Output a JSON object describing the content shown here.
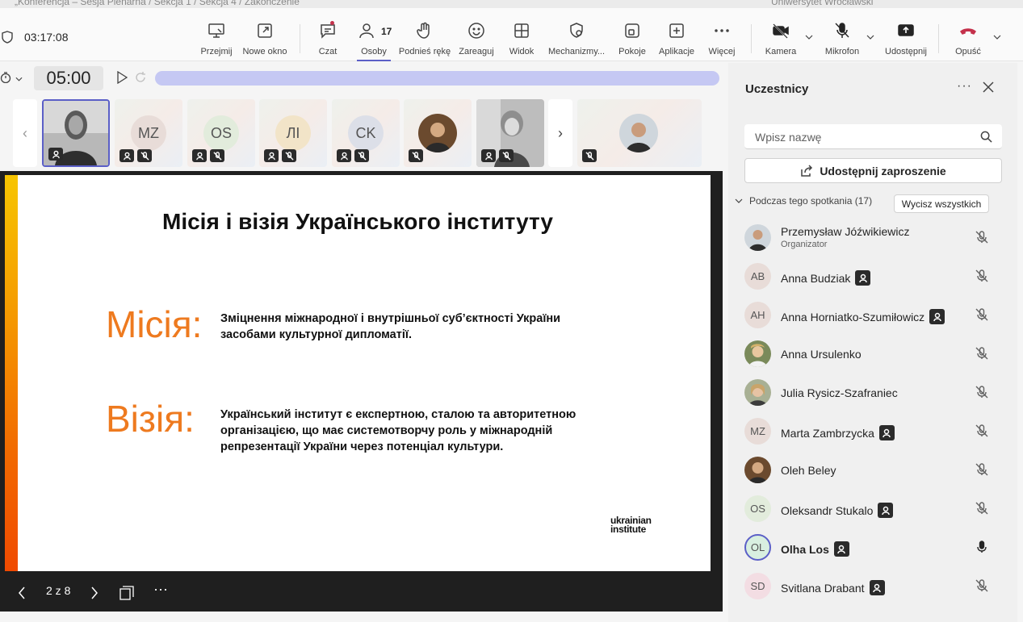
{
  "window": {
    "title": "„Konferencja – Sesja Plenarna / Sekcja 1 / Sekcja 4 / Zakończenie",
    "org": "Uniwersytet Wrocławski"
  },
  "toolbar": {
    "elapsed": "03:17:08",
    "buttons": {
      "take_control": "Przejmij",
      "new_window": "Nowe okno",
      "chat": "Czat",
      "people": "Osoby",
      "people_count": "17",
      "raise_hand": "Podnieś rękę",
      "react": "Zareaguj",
      "view": "Widok",
      "mechanisms": "Mechanizmy...",
      "rooms": "Pokoje",
      "apps": "Aplikacje",
      "more": "Więcej",
      "camera": "Kamera",
      "mic": "Mikrofon",
      "share": "Udostępnij",
      "leave": "Opuść"
    }
  },
  "timer": {
    "countdown": "05:00"
  },
  "strip": {
    "tiles": [
      {
        "initials": ""
      },
      {
        "initials": "MZ"
      },
      {
        "initials": "OS"
      },
      {
        "initials": "ЛІ"
      },
      {
        "initials": "CK"
      }
    ]
  },
  "slide": {
    "title": "Місія і візія Українського інституту",
    "mission_label": "Місія:",
    "mission_text_1": "Зміцнення міжнародної і внутрішньої суб’єктності України",
    "mission_text_2": "засобами культурної дипломатії.",
    "vision_label": "Візія:",
    "vision_text_1": "Український інститут є експертною, сталою та авторитетною",
    "vision_text_2": "організацією, що має системотворчу роль у міжнародній",
    "vision_text_3": "репрезентації України через потенціал культури.",
    "logo_1": "ukrainian",
    "logo_2": "institute",
    "page": "2 z 8"
  },
  "panel": {
    "title": "Uczestnicy",
    "search_placeholder": "Wpisz nazwę",
    "invite": "Udostępnij zaproszenie",
    "section": "Podczas tego spotkania (17)",
    "mute_all": "Wycisz wszystkich",
    "people": [
      {
        "name": "Przemysław Jóźwikiewicz",
        "role": "Organizator",
        "initials": "",
        "photo": true,
        "badge": false,
        "mic_on": false
      },
      {
        "name": "Anna Budziak",
        "initials": "AB",
        "badge": true,
        "mic_on": false
      },
      {
        "name": "Anna Horniatko-Szumiłowicz",
        "initials": "AH",
        "badge": true,
        "mic_on": false
      },
      {
        "name": "Anna Ursulenko",
        "initials": "",
        "photo": true,
        "badge": false,
        "mic_on": false
      },
      {
        "name": "Julia Rysicz-Szafraniec",
        "initials": "",
        "photo": true,
        "badge": false,
        "mic_on": false
      },
      {
        "name": "Marta Zambrzycka",
        "initials": "MZ",
        "badge": true,
        "mic_on": false
      },
      {
        "name": "Oleh Beley",
        "initials": "",
        "photo": true,
        "badge": false,
        "mic_on": false
      },
      {
        "name": "Oleksandr Stukalo",
        "initials": "OS",
        "badge": true,
        "mic_on": false
      },
      {
        "name": "Olha Los",
        "initials": "OL",
        "badge": true,
        "mic_on": true
      },
      {
        "name": "Svitlana Drabant",
        "initials": "SD",
        "badge": true,
        "mic_on": false
      }
    ]
  },
  "colors": {
    "accent": "#5b5fc7",
    "slide_orange": "#ee7a1f",
    "leave_red": "#c4314b"
  }
}
